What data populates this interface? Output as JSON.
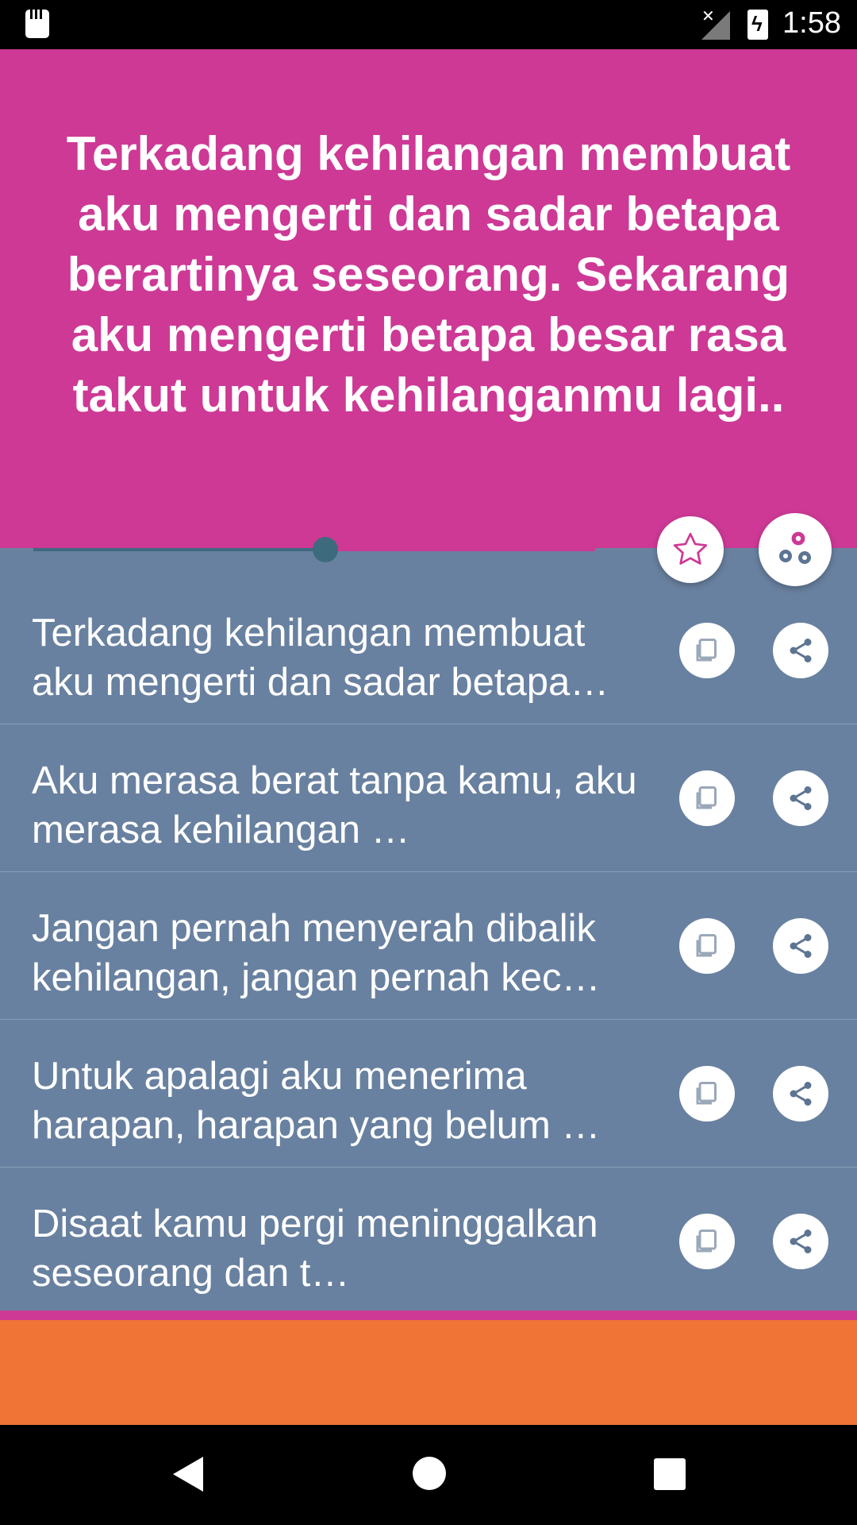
{
  "status_bar": {
    "time": "1:58"
  },
  "header": {
    "quote": "Terkadang kehilangan membuat aku mengerti dan sadar betapa berartinya seseorang. Sekarang aku mengerti betapa besar rasa takut untuk kehilanganmu lagi.."
  },
  "progress": {
    "value": 0.52
  },
  "colors": {
    "header": "#cd3995",
    "list_bg": "#6981a0",
    "ad": "#ef7436",
    "accent": "#3e6a7e"
  },
  "icons": {
    "favorite": "star-icon",
    "settings": "gears-icon",
    "copy": "copy-icon",
    "share": "share-icon"
  },
  "items": [
    {
      "text": "Terkadang kehilangan membuat aku mengerti dan sadar betapa…"
    },
    {
      "text": "Aku merasa berat tanpa kamu, aku merasa kehilangan …"
    },
    {
      "text": "Jangan pernah menyerah dibalik kehilangan, jangan pernah kec…"
    },
    {
      "text": "Untuk apalagi aku menerima harapan, harapan yang belum …"
    },
    {
      "text": "Disaat kamu pergi meninggalkan seseorang dan t…"
    }
  ]
}
